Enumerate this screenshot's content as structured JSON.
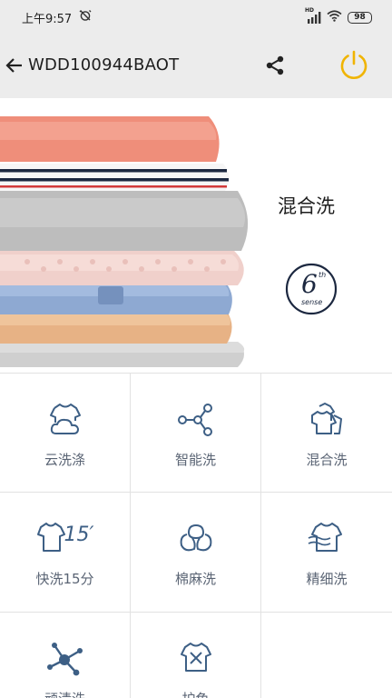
{
  "status_bar": {
    "time": "上午9:57",
    "network_badge": "HD",
    "battery": "98"
  },
  "header": {
    "title": "WDD100944BAOT"
  },
  "hero": {
    "program": "混合洗",
    "badge_superscript": "th",
    "badge_number": "6",
    "badge_word": "sense"
  },
  "programs": [
    {
      "label": "云洗涤",
      "icon": "cloud-shirt-icon"
    },
    {
      "label": "智能洗",
      "icon": "share-nodes-icon"
    },
    {
      "label": "混合洗",
      "icon": "mixed-clothes-icon"
    },
    {
      "label": "快洗15分",
      "icon": "quick-wash-15-icon",
      "icon_text": "15′"
    },
    {
      "label": "棉麻洗",
      "icon": "cotton-flower-icon"
    },
    {
      "label": "精细洗",
      "icon": "delicate-shirt-icon"
    },
    {
      "label": "顽渍洗",
      "icon": "stain-splash-icon"
    },
    {
      "label": "护色",
      "icon": "color-care-icon"
    },
    {
      "label": "",
      "icon": ""
    }
  ],
  "colors": {
    "header_bg": "#ececec",
    "accent_power": "#f0b400",
    "icon_blue": "#3d5f85",
    "label_gray": "#5a6474",
    "divider": "#e2e2e2"
  }
}
